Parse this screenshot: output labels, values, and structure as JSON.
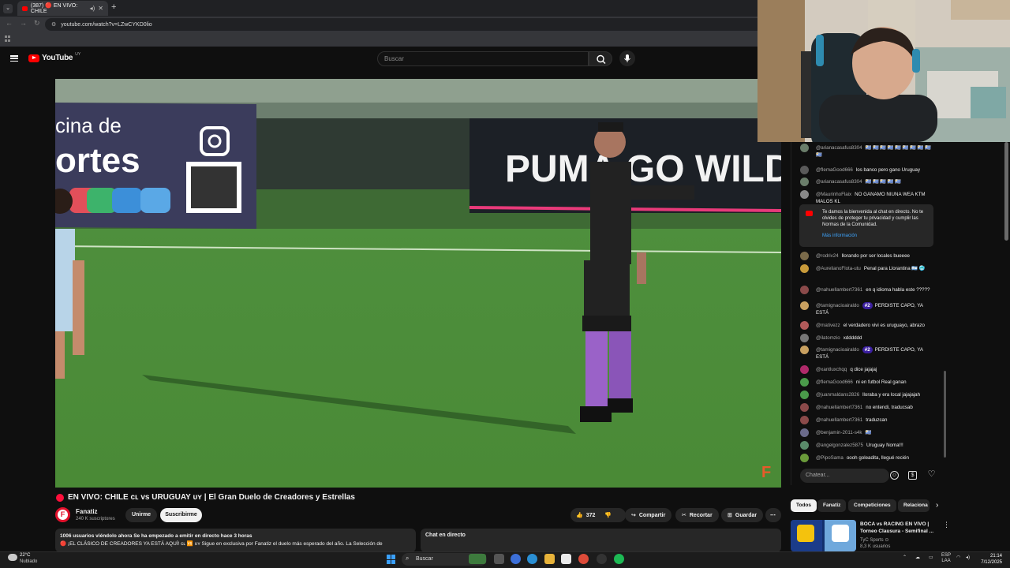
{
  "browser": {
    "tab_title": "(387) 🔴 EN VIVO: CHILE",
    "url": "youtube.com/watch?v=LZwCYKD0lio"
  },
  "yt": {
    "logo": "YouTube",
    "logo_country": "UY",
    "search_placeholder": "Buscar"
  },
  "video": {
    "sponsor_left_1": "cina de",
    "sponsor_left_2": "ortes",
    "sponsor_right": "PUMA GO WILD"
  },
  "title": "EN VIVO: CHILE ᴄʟ vs URUGUAY ᴜʏ | El Gran Duelo de Creadores y Estrellas",
  "channel": {
    "avatar_letter": "F",
    "name": "Fanatiz",
    "subs": "240 K suscriptores",
    "join": "Unirme",
    "subscribe": "Suscribirme"
  },
  "actions": {
    "likes": "372",
    "share": "Compartir",
    "clip": "Recortar",
    "save": "Guardar"
  },
  "description": {
    "line1": "1006 usuarios viéndolo ahora  Se ha empezado a emitir en directo hace 3 horas",
    "line2": "🔴 ¡EL CLÁSICO DE CREADORES YA ESTÁ AQUÍ! ᴄʟ 🆚 ᴜʏ Sigue en exclusiva por Fanatiz el duelo más esperado del año. La Selección de"
  },
  "chat_bottom_label": "Chat en directo",
  "chat": {
    "messages": [
      {
        "author": "@arianacasafus8304",
        "text": "🇺🇾 🇺🇾 🇺🇾 🇺🇾 🇺🇾 🇺🇾 🇺🇾 🇺🇾 🇺🇾 🇺🇾",
        "badge": ""
      },
      {
        "author": "@flemaGood666",
        "text": "los banco pero gano Uruguay",
        "badge": ""
      },
      {
        "author": "@arianacasafus8304",
        "text": "🇺🇾 🇺🇾 🇺🇾 🇺🇾 🇺🇾",
        "badge": ""
      },
      {
        "author": "@MaurinhoFlaix",
        "text": "NO GANAMO NIUNA WEA KTM MALOS KL",
        "badge": ""
      },
      {
        "author": "@rodriv24",
        "text": "llorando por ser locales bueeee",
        "badge": ""
      },
      {
        "author": "@AurelianoFlota-utu",
        "text": "Penal para Llorantina 🇦🇷 🥶",
        "badge": ""
      },
      {
        "author": "@nahuellambert7361",
        "text": "en q idioma habla este ?????",
        "badge": ""
      },
      {
        "author": "@tamignacioairaldo",
        "text": "PERDISTE CAPO, YA ESTÁ",
        "badge": "#2"
      },
      {
        "author": "@mativezz",
        "text": "el verdadero vivi es uruguayo, abrazo",
        "badge": ""
      },
      {
        "author": "@ilatomzio",
        "text": "xdddddd",
        "badge": ""
      },
      {
        "author": "@tamignacioairaldo",
        "text": "PERDISTE CAPO, YA ESTÁ",
        "badge": "#2"
      },
      {
        "author": "@xantluxchqq",
        "text": "q dice jajajaj",
        "badge": ""
      },
      {
        "author": "@flemaGood666",
        "text": "ni en futbol Real ganan",
        "badge": ""
      },
      {
        "author": "@juanmaldans2826",
        "text": "lloraba y era local jajajajah",
        "badge": ""
      },
      {
        "author": "@nahuellambert7361",
        "text": "no entendi, traducsab",
        "badge": ""
      },
      {
        "author": "@nahuellambert7361",
        "text": "traduzcan",
        "badge": ""
      },
      {
        "author": "@benjamin-2011-s4k",
        "text": "🇺🇾",
        "badge": ""
      },
      {
        "author": "@angelgonzalez5875",
        "text": "Uruguay Nomaǃǃǃ",
        "badge": ""
      },
      {
        "author": "@PipoSama",
        "text": "oooh goleadita, llegué recién",
        "badge": ""
      }
    ],
    "notice": "Te damos la bienvenida al chat en directo. No te olvides de proteger tu privacidad y cumplir las Normas de la Comunidad.",
    "notice_link": "Más información",
    "input_placeholder": "Chatear..."
  },
  "chips": [
    "Todos",
    "Fanatiz",
    "Competiciones",
    "Relaciona"
  ],
  "recommended": {
    "title": "BOCA vs RACING EN VIVO | Torneo Clausura - Semifinal ...",
    "channel": "TyC Sports ⊙",
    "views": "8,3 K usuarios"
  },
  "taskbar": {
    "temp": "22°C",
    "condition": "Nublado",
    "search": "Buscar",
    "lang1": "ESP",
    "lang2": "LAA",
    "time": "21:14",
    "date": "7/12/2025"
  }
}
